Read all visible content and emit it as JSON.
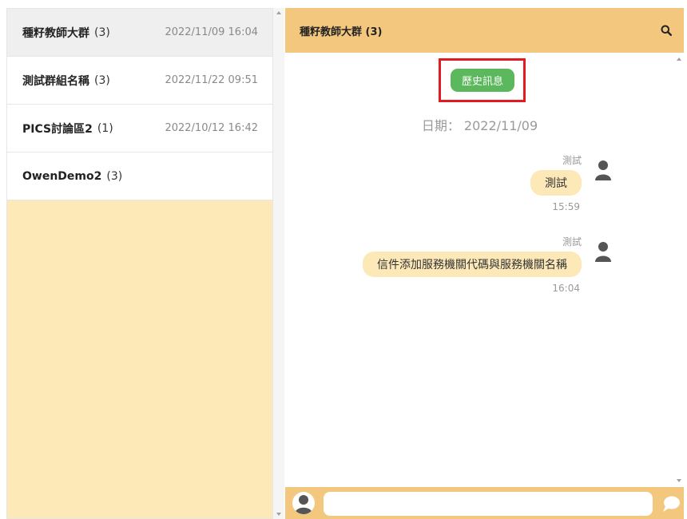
{
  "groups": [
    {
      "name": "種籽教師大群",
      "count": "(3)",
      "time": "2022/11/09 16:04"
    },
    {
      "name": "測試群組名稱",
      "count": "(3)",
      "time": "2022/11/22 09:51"
    },
    {
      "name": "PICS討論區2",
      "count": "(1)",
      "time": "2022/10/12 16:42"
    },
    {
      "name": "OwenDemo2",
      "count": "(3)",
      "time": ""
    }
  ],
  "chat": {
    "title": "種籽教師大群 (3)",
    "history_button": "歷史訊息",
    "date_label": "日期： 2022/11/09",
    "messages": [
      {
        "sender": "測試",
        "text": "測試",
        "time": "15:59"
      },
      {
        "sender": "測試",
        "text": "信件添加服務機關代碼與服務機關名稱",
        "time": "16:04"
      }
    ],
    "input_value": ""
  },
  "icons": {
    "search": "search-icon",
    "avatar": "user-avatar-icon",
    "send": "chat-bubble-send-icon"
  },
  "colors": {
    "header_accent": "#f3c77e",
    "panel_bg": "#fde9b8",
    "history_button": "#5cb85c",
    "highlight_border": "#e21b23"
  }
}
